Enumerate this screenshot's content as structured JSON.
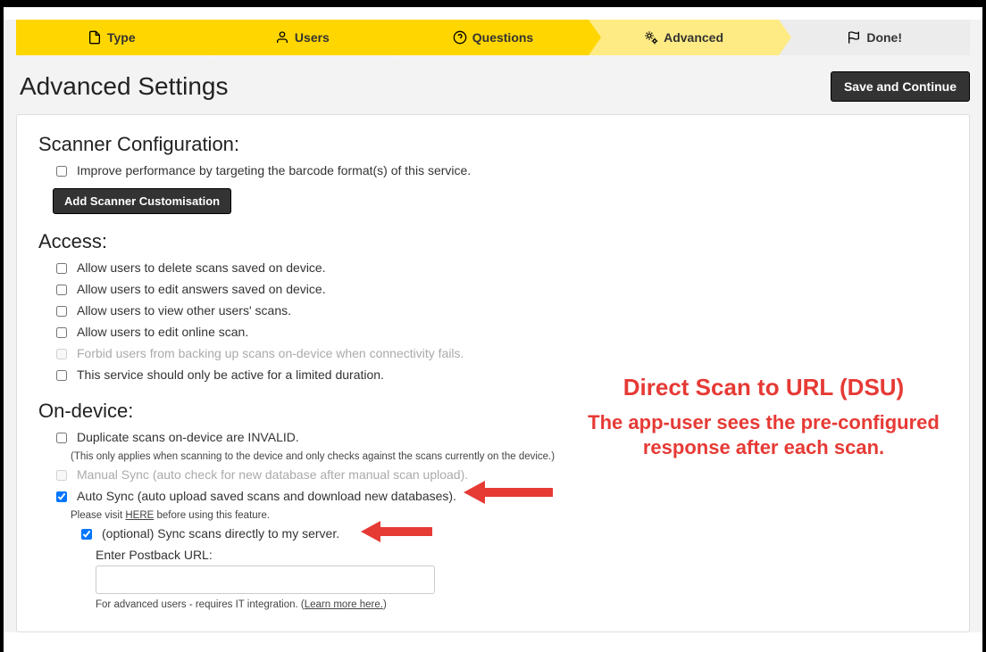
{
  "steps": [
    {
      "label": "Type"
    },
    {
      "label": "Users"
    },
    {
      "label": "Questions"
    },
    {
      "label": "Advanced"
    },
    {
      "label": "Done!"
    }
  ],
  "page_title": "Advanced Settings",
  "save_btn": "Save and Continue",
  "scanner": {
    "heading": "Scanner Configuration:",
    "opt_perf": "Improve performance by targeting the barcode format(s) of this service.",
    "add_btn": "Add Scanner Customisation"
  },
  "access": {
    "heading": "Access:",
    "opt_delete": "Allow users to delete scans saved on device.",
    "opt_edit_answers": "Allow users to edit answers saved on device.",
    "opt_view_other": "Allow users to view other users' scans.",
    "opt_edit_online": "Allow users to edit online scan.",
    "opt_forbid_backup": "Forbid users from backing up scans on-device when connectivity fails.",
    "opt_limited": "This service should only be active for a limited duration."
  },
  "ondevice": {
    "heading": "On-device:",
    "opt_dup": "Duplicate scans on-device are INVALID.",
    "dup_note": "(This only applies when scanning to the device and only checks against the scans currently on the device.)",
    "opt_manual": "Manual Sync (auto check for new database after manual scan upload).",
    "opt_auto": "Auto Sync (auto upload saved scans and download new databases).",
    "auto_note_prefix": "Please visit ",
    "auto_note_link": "HERE",
    "auto_note_suffix": " before using this feature.",
    "opt_direct": "(optional) Sync scans directly to my server.",
    "postback_label": "Enter Postback URL:",
    "postback_value": "",
    "postback_note_prefix": "For advanced users - requires IT integration. (",
    "postback_note_link": "Learn more here.",
    "postback_note_suffix": ")"
  },
  "annotation": {
    "title": "Direct Scan to URL (DSU)",
    "body": "The app-user sees the pre-configured response after each scan."
  }
}
